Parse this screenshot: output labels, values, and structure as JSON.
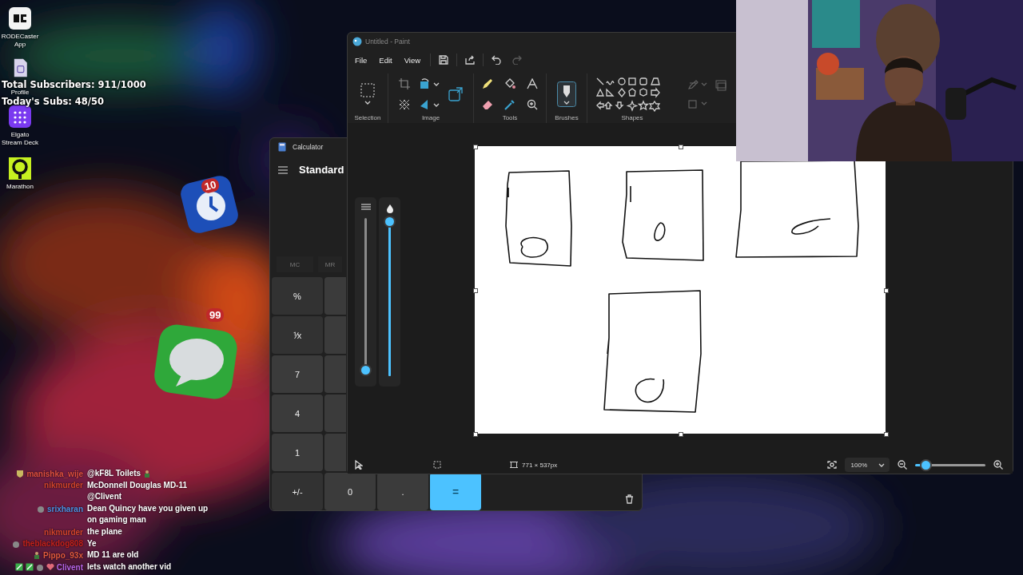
{
  "desktop_icons": [
    {
      "kind": "rode",
      "label": "RODECaster App"
    },
    {
      "kind": "profile",
      "label": "Profile"
    },
    {
      "kind": "deck",
      "label": "Elgato Stream Deck"
    },
    {
      "kind": "marathon",
      "label": "Marathon"
    }
  ],
  "overlay": {
    "total_subscribers": "Total Subscribers: 911/1000",
    "todays_subs": "Today's Subs: 48/50"
  },
  "floating_apps": [
    {
      "kind": "alarm",
      "count": "10"
    },
    {
      "kind": "messages",
      "count": "99"
    }
  ],
  "calculator": {
    "title": "Calculator",
    "mode": "Standard",
    "memory": [
      "MC",
      "MR"
    ],
    "keys": [
      {
        "label": "%",
        "kind": "function"
      },
      {
        "label": "⅟x",
        "kind": "function"
      },
      {
        "label": "7",
        "kind": "digit"
      },
      {
        "label": "4",
        "kind": "digit"
      },
      {
        "label": "1",
        "kind": "digit"
      },
      {
        "label": "+/-",
        "kind": "function"
      },
      {
        "label": "0",
        "kind": "digit"
      },
      {
        "label": ".",
        "kind": "digit"
      },
      {
        "label": "=",
        "kind": "accent"
      }
    ]
  },
  "paint": {
    "title": "Untitled - Paint",
    "menu": [
      "File",
      "Edit",
      "View"
    ],
    "redo_disabled": true,
    "groups": [
      "Selection",
      "Image",
      "Tools",
      "Brushes",
      "Shapes"
    ],
    "sliders": [
      {
        "kind": "size",
        "level": 0.02
      },
      {
        "kind": "opacity",
        "level": 1
      }
    ],
    "status": {
      "canvas_size": "771 × 537px",
      "zoom": "100%",
      "zoom_level": {
        "level": 0.16
      }
    }
  },
  "chat": [
    {
      "badges": [
        {
          "kind": "shield"
        }
      ],
      "user": "manishka_wije",
      "color": "#e0503f",
      "message": "@kF8L Toilets",
      "emote": {
        "kind": "figure"
      }
    },
    {
      "user": "nikmurder",
      "color": "#d2442c",
      "message": "McDonnell Douglas MD-11 @Clivent"
    },
    {
      "badges": [
        {
          "kind": "helmet"
        }
      ],
      "user": "srixharan",
      "color": "#4d8fe0",
      "message": "Dean Quincy have you given up on gaming man"
    },
    {
      "user": "nikmurder",
      "color": "#d2442c",
      "message": "the plane"
    },
    {
      "badges": [
        {
          "kind": "helmet"
        }
      ],
      "user": "theblackdog808",
      "color": "#c4221c",
      "message": "Ye"
    },
    {
      "badges": [
        {
          "kind": "figure"
        }
      ],
      "user": "Pippo_93x",
      "color": "#e05a3e",
      "message": "MD 11 are old"
    },
    {
      "badges": [
        {
          "kind": "sword"
        },
        {
          "kind": "sword"
        },
        {
          "kind": "helmet"
        },
        {
          "kind": "heart"
        }
      ],
      "user": "Clivent",
      "color": "#b865e8",
      "message": "lets watch another vid"
    }
  ]
}
